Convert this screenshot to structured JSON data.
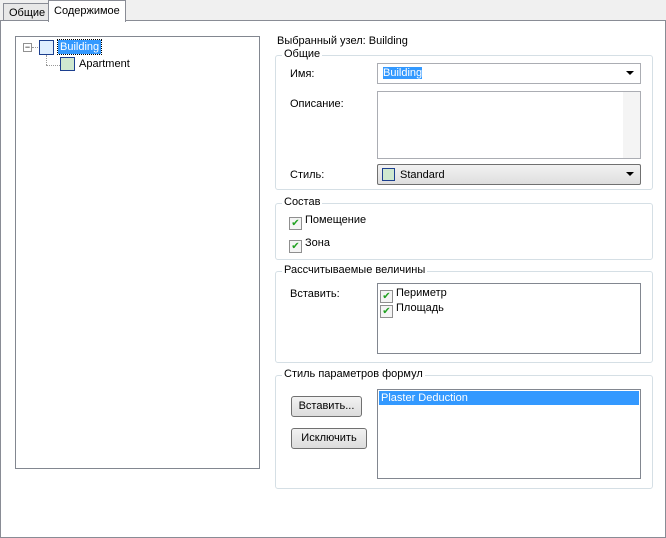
{
  "tabs": [
    {
      "label": "Общие"
    },
    {
      "label": "Содержимое"
    }
  ],
  "tree": {
    "root": "Building",
    "child": "Apartment"
  },
  "selected_node": "Выбранный узел: Building",
  "general": {
    "title": "Общие",
    "name_label": "Имя:",
    "name_value": "Building",
    "description_label": "Описание:",
    "description_value": "",
    "style_label": "Стиль:",
    "style_value": "Standard"
  },
  "composition": {
    "title": "Состав",
    "items": [
      {
        "label": "Помещение",
        "checked": true
      },
      {
        "label": "Зона",
        "checked": true
      }
    ]
  },
  "calculated": {
    "title": "Рассчитываемые величины",
    "insert_label": "Вставить:",
    "items": [
      {
        "label": "Периметр",
        "checked": true
      },
      {
        "label": "Площадь",
        "checked": true
      }
    ]
  },
  "formula": {
    "title": "Стиль параметров формул",
    "insert_button": "Вставить...",
    "exclude_button": "Исключить",
    "items": [
      "Plaster Deduction"
    ]
  }
}
